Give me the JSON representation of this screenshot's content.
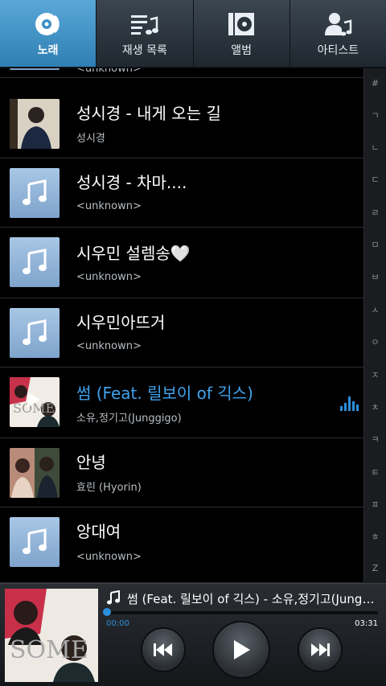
{
  "tabs": [
    {
      "label": "노래",
      "icon": "disc-icon",
      "active": true
    },
    {
      "label": "재생 목록",
      "icon": "playlist-icon",
      "active": false
    },
    {
      "label": "앨범",
      "icon": "album-icon",
      "active": false
    },
    {
      "label": "아티스트",
      "icon": "artist-icon",
      "active": false
    }
  ],
  "songs": [
    {
      "title": "",
      "artist": "<unknown>",
      "thumb": "generic"
    },
    {
      "title": "성시경 - 내게 오는 길",
      "artist": "성시경",
      "thumb": "photo"
    },
    {
      "title": "성시경 - 차마....",
      "artist": "<unknown>",
      "thumb": "generic"
    },
    {
      "title": "시우민 설렘송🤍",
      "artist": "<unknown>",
      "thumb": "generic"
    },
    {
      "title": "시우민아뜨거",
      "artist": "<unknown>",
      "thumb": "generic"
    },
    {
      "title": "썸 (Feat. 릴보이 of 긱스)",
      "artist": "소유,정기고(Junggigo)",
      "thumb": "photo",
      "playing": true
    },
    {
      "title": "안녕",
      "artist": "효린 (Hyorin)",
      "thumb": "photo"
    },
    {
      "title": "앙대여",
      "artist": "<unknown>",
      "thumb": "generic"
    }
  ],
  "index_letters": [
    "#",
    "ㄱ",
    "ㄴ",
    "ㄷ",
    "ㄹ",
    "ㅁ",
    "ㅂ",
    "ㅅ",
    "ㅇ",
    "ㅈ",
    "ㅊ",
    "ㅋ",
    "ㅌ",
    "ㅍ",
    "ㅎ",
    "Z"
  ],
  "player": {
    "now_playing": "썸 (Feat. 릴보이 of 긱스) - 소유,정기고(Jungg...",
    "elapsed": "00:00",
    "duration": "03:31",
    "progress": 0.0
  },
  "colors": {
    "accent": "#2d8fdc",
    "playing_text": "#3fa3ee",
    "tab_active": "#3a8fc6"
  }
}
